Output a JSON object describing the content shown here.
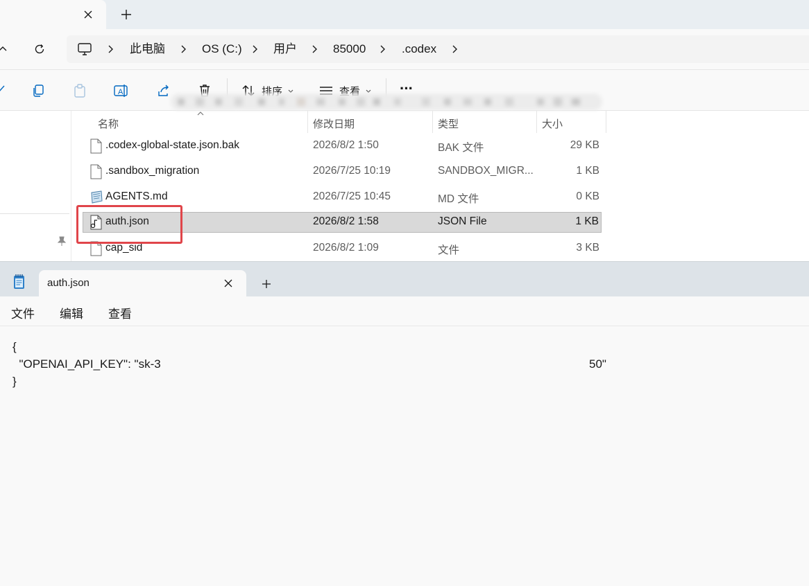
{
  "explorer": {
    "breadcrumb": [
      "此电脑",
      "OS (C:)",
      "用户",
      "85000",
      ".codex"
    ],
    "commands": {
      "sort_label": "排序",
      "view_label": "查看",
      "more_label": "···"
    },
    "columns": {
      "name": "名称",
      "modified": "修改日期",
      "type": "类型",
      "size": "大小"
    },
    "files": [
      {
        "name": ".codex-global-state.json.bak",
        "modified": "2026/8/2 1:50",
        "type": "BAK 文件",
        "size": "29 KB"
      },
      {
        "name": ".sandbox_migration",
        "modified": "2026/7/25 10:19",
        "type": "SANDBOX_MIGR...",
        "size": "1 KB"
      },
      {
        "name": "AGENTS.md",
        "modified": "2026/7/25 10:45",
        "type": "MD 文件",
        "size": "0 KB"
      },
      {
        "name": "auth.json",
        "modified": "2026/8/2 1:58",
        "type": "JSON File",
        "size": "1 KB",
        "selected": true
      },
      {
        "name": "cap_sid",
        "modified": "2026/8/2 1:09",
        "type": "文件",
        "size": "3 KB"
      }
    ]
  },
  "notepad": {
    "tab_title": "auth.json",
    "menu": {
      "file": "文件",
      "edit": "编辑",
      "view": "查看"
    },
    "content": {
      "line1": "{",
      "line2_prefix": "  \"OPENAI_API_KEY\": \"sk-3",
      "line2_suffix": "50\"",
      "line3": "}"
    }
  },
  "colors": {
    "highlight": "#e0454a",
    "selection": "#d9d9d9",
    "accent": "#0067c0"
  }
}
